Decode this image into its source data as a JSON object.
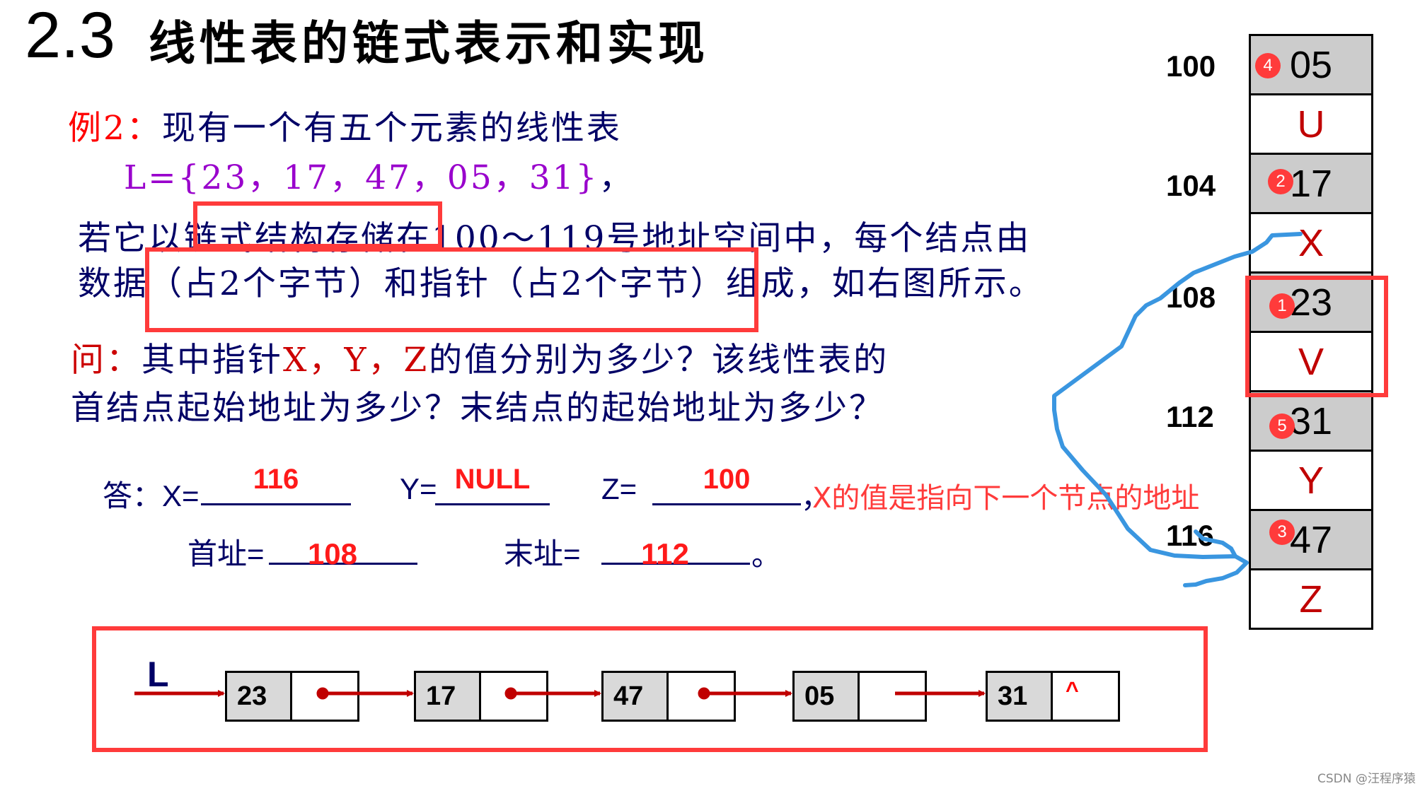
{
  "title": {
    "number": "2.3",
    "text": "线性表的链式表示和实现"
  },
  "example": {
    "label": "例2：",
    "line1": "现有一个有五个元素的线性表",
    "list_def": "L={23，17，47，05，31}",
    "list_def_tail": "，",
    "para1_line1": "若它以链式结构存储在100～119号地址空间中，每个结点由",
    "para1_line2": "数据（占2个字节）和指针（占2个字节）组成，如右图所示。"
  },
  "question": {
    "label": "问：",
    "line1_a": "其中指针",
    "line1_vars": "X，Y，Z",
    "line1_b": "的值分别为多少？该线性表的",
    "line2": "首结点起始地址为多少？末结点的起始地址为多少？"
  },
  "answer": {
    "label": "答：",
    "x_label": "X=",
    "x_value": "116",
    "y_label": "Y=",
    "y_value": "NULL",
    "z_label": "Z=",
    "z_value": "100",
    "comma": "，",
    "note": "X的值是指向下一个节点的地址",
    "head_label": "首址=",
    "head_value": "108",
    "tail_label": "末址=",
    "tail_value": "112",
    "end_mark": "。"
  },
  "memory": {
    "addresses": [
      "100",
      "104",
      "108",
      "112",
      "116"
    ],
    "cells": [
      {
        "type": "data",
        "value": "05",
        "badge": "4"
      },
      {
        "type": "ptr",
        "value": "U"
      },
      {
        "type": "data",
        "value": "17",
        "badge": "2"
      },
      {
        "type": "ptr",
        "value": "X"
      },
      {
        "type": "data",
        "value": "23",
        "badge": "1"
      },
      {
        "type": "ptr",
        "value": "V"
      },
      {
        "type": "data",
        "value": "31",
        "badge": "5"
      },
      {
        "type": "ptr",
        "value": "Y"
      },
      {
        "type": "data",
        "value": "47",
        "badge": "3"
      },
      {
        "type": "ptr",
        "value": "Z"
      }
    ]
  },
  "linked_list": {
    "head_label": "L",
    "nodes": [
      "23",
      "17",
      "47",
      "05",
      "31"
    ],
    "null_symbol": "^"
  },
  "colors": {
    "highlight": "#ff3b3b",
    "navy": "#000066",
    "pointer_red": "#c00000",
    "pen_blue": "#3a96e0"
  },
  "watermark": "CSDN @汪程序猿"
}
